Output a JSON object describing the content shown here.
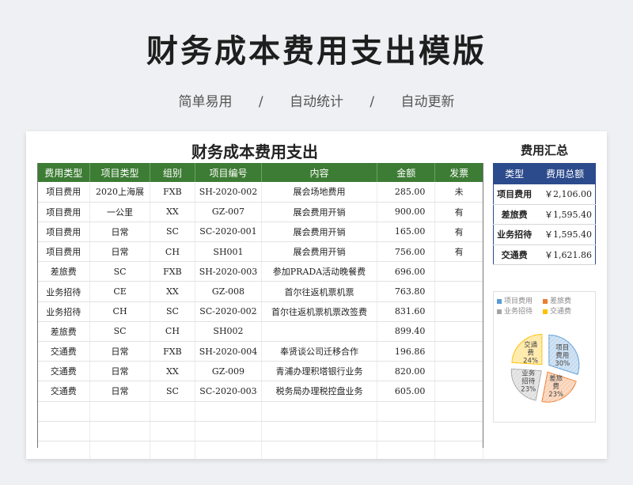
{
  "title": "财务成本费用支出模版",
  "subtitle": [
    "简单易用",
    "/",
    "自动统计",
    "/",
    "自动更新"
  ],
  "sheet_title": "财务成本费用支出",
  "table": {
    "headers": [
      "费用类型",
      "项目类型",
      "组别",
      "项目编号",
      "内容",
      "金额",
      "发票"
    ],
    "rows": [
      [
        "项目费用",
        "2020上海展",
        "FXB",
        "SH-2020-002",
        "展会场地费用",
        "285.00",
        "未"
      ],
      [
        "项目费用",
        "一公里",
        "XX",
        "GZ-007",
        "展会费用开销",
        "900.00",
        "有"
      ],
      [
        "项目费用",
        "日常",
        "SC",
        "SC-2020-001",
        "展会费用开销",
        "165.00",
        "有"
      ],
      [
        "项目费用",
        "日常",
        "CH",
        "SH001",
        "展会费用开销",
        "756.00",
        "有"
      ],
      [
        "差旅费",
        "SC",
        "FXB",
        "SH-2020-003",
        "参加PRADA活动晚餐费",
        "696.00",
        ""
      ],
      [
        "业务招待",
        "CE",
        "XX",
        "GZ-008",
        "首尔往返机票机票",
        "763.80",
        ""
      ],
      [
        "业务招待",
        "CH",
        "SC",
        "SC-2020-002",
        "首尔往返机票机票改签费",
        "831.60",
        ""
      ],
      [
        "差旅费",
        "SC",
        "CH",
        "SH002",
        "",
        "899.40",
        ""
      ],
      [
        "交通费",
        "日常",
        "FXB",
        "SH-2020-004",
        "奉贤谈公司迁移合作",
        "196.86",
        ""
      ],
      [
        "交通费",
        "日常",
        "XX",
        "GZ-009",
        "青浦办理积塔银行业务",
        "820.00",
        ""
      ],
      [
        "交通费",
        "日常",
        "SC",
        "SC-2020-003",
        "税务局办理税控盘业务",
        "605.00",
        ""
      ],
      [
        "",
        "",
        "",
        "",
        "",
        "",
        ""
      ],
      [
        "",
        "",
        "",
        "",
        "",
        "",
        ""
      ],
      [
        "",
        "",
        "",
        "",
        "",
        "",
        ""
      ]
    ]
  },
  "summary": {
    "title": "费用汇总",
    "headers": [
      "类型",
      "费用总额"
    ],
    "rows": [
      [
        "项目费用",
        "￥2,106.00"
      ],
      [
        "差旅费",
        "￥1,595.40"
      ],
      [
        "业务招待",
        "￥1,595.40"
      ],
      [
        "交通费",
        "￥1,621.86"
      ]
    ]
  },
  "chart_data": {
    "type": "pie",
    "categories": [
      "项目费用",
      "差旅费",
      "业务招待",
      "交通费"
    ],
    "values": [
      30,
      23,
      23,
      24
    ],
    "labels": [
      "项目\n费用\n30%",
      "差旅\n费\n23%",
      "业务\n招待\n23%",
      "交通\n费\n24%"
    ],
    "colors": [
      "#5b9bd5",
      "#ed7d31",
      "#a5a5a5",
      "#ffc000"
    ],
    "legend": "top"
  }
}
